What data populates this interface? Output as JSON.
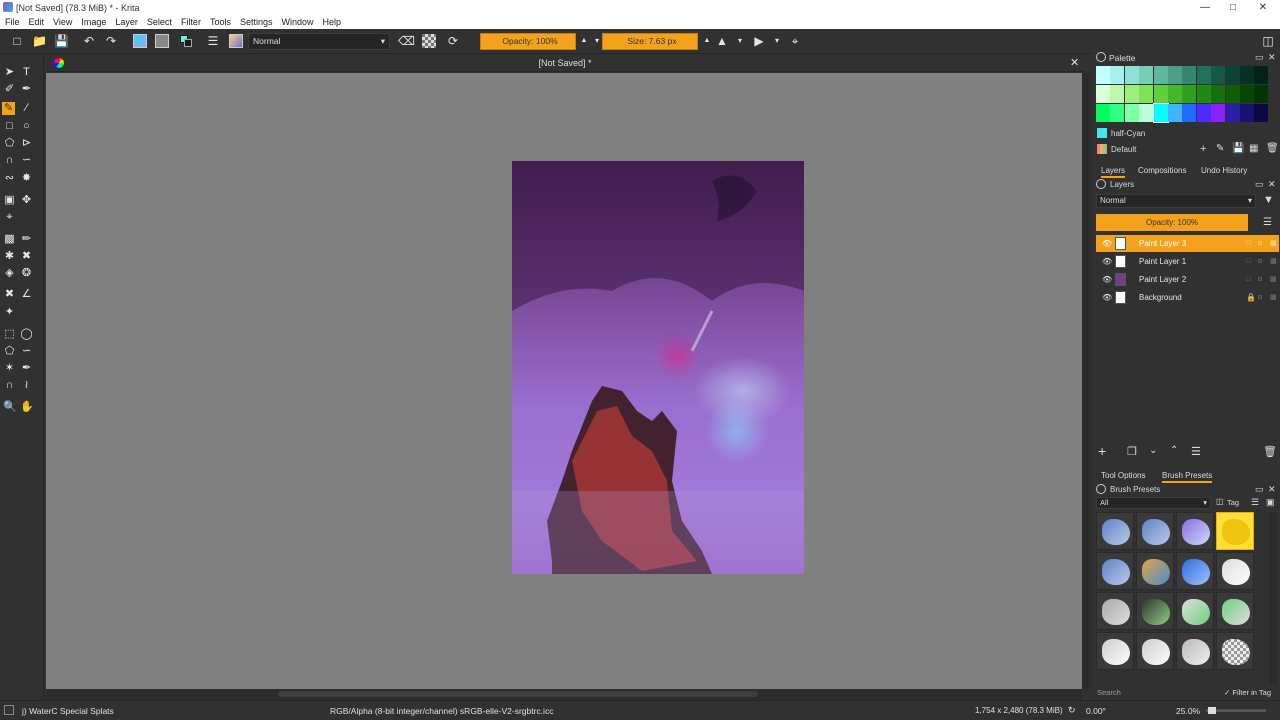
{
  "window": {
    "title": "[Not Saved]  (78.3 MiB)  * - Krita",
    "min_icon": "minimize-icon",
    "max_icon": "maximize-icon",
    "close_icon": "close-icon"
  },
  "menu": [
    "File",
    "Edit",
    "View",
    "Image",
    "Layer",
    "Select",
    "Filter",
    "Tools",
    "Settings",
    "Window",
    "Help"
  ],
  "toolbar": {
    "blend_mode": "Normal",
    "opacity": "Opacity: 100%",
    "size": "Size: 7.63 px"
  },
  "canvas": {
    "tab_title": "[Not Saved]  *"
  },
  "palette": {
    "title": "Palette",
    "selected_color_name": "half-Cyan",
    "palette_name": "Default",
    "colors": [
      "#bfffff",
      "#a6f0f0",
      "#8fe0d8",
      "#79cdb6",
      "#61b79e",
      "#4a9f86",
      "#35886f",
      "#226f5a",
      "#145846",
      "#0b4334",
      "#063124",
      "#04241a",
      "#d9ffd9",
      "#bff7a8",
      "#9ef07a",
      "#7fe35a",
      "#5fcf3c",
      "#42b82a",
      "#2ea21e",
      "#1f8a14",
      "#14720d",
      "#0c5c08",
      "#064604",
      "#033402",
      "#00ff5a",
      "#30ff80",
      "#7dffa8",
      "#b8ffd6",
      "#00ffff",
      "#3fb6ff",
      "#1f6aff",
      "#4d2cff",
      "#8b20ff",
      "#2b1fa8",
      "#1a1270",
      "#0c0a45"
    ]
  },
  "layers_docker": {
    "tabs": [
      "Layers",
      "Compositions",
      "Undo History"
    ],
    "title": "Layers",
    "blend_mode": "Normal",
    "opacity": "Opacity: 100%",
    "layers": [
      {
        "name": "Paint Layer 3",
        "selected": true
      },
      {
        "name": "Paint Layer 1",
        "selected": false
      },
      {
        "name": "Paint Layer 2",
        "selected": false
      },
      {
        "name": "Background",
        "selected": false
      }
    ]
  },
  "presets_docker": {
    "tabs": [
      "Tool Options",
      "Brush Presets"
    ],
    "title": "Brush Presets",
    "tag_filter": "All",
    "tag_label": "Tag",
    "search_placeholder": "Search",
    "filter_in_tag": "Filter in Tag"
  },
  "status": {
    "brush_name": "j) WaterC Special Splats",
    "color_profile": "RGB/Alpha (8-bit integer/channel)  sRGB-elle-V2-srgbtrc.icc",
    "image_size": "1,754 x 2,480 (78.3 MiB)",
    "rotation": "0.00°",
    "zoom": "25.0%"
  }
}
